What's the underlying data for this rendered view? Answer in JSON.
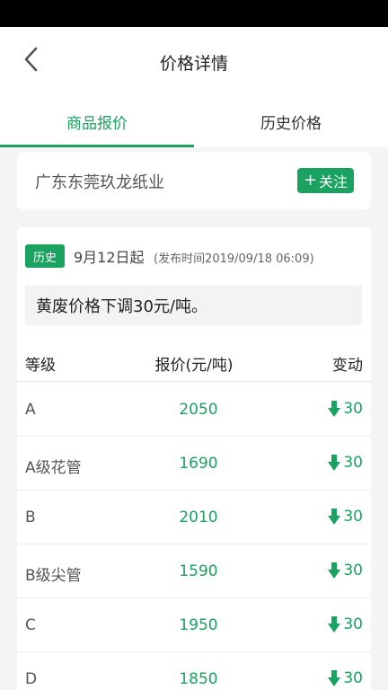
{
  "nav": {
    "title": "价格详情"
  },
  "tabs": [
    {
      "label": "商品报价",
      "active": true
    },
    {
      "label": "历史价格",
      "active": false
    }
  ],
  "company": {
    "name": "广东东莞玖龙纸业",
    "follow_plus": "+",
    "follow_label": "关注"
  },
  "detail": {
    "badge": "历史",
    "start_date": "9月12日起",
    "publish_time": "(发布时间2019/09/18 06:09)",
    "notice": "黄废价格下调30元/吨。"
  },
  "table": {
    "headers": {
      "grade": "等级",
      "price": "报价(元/吨)",
      "change": "变动"
    },
    "rows": [
      {
        "grade": "A",
        "price": "2050",
        "change": "30"
      },
      {
        "grade": "A级花管",
        "price": "1690",
        "change": "30"
      },
      {
        "grade": "B",
        "price": "2010",
        "change": "30"
      },
      {
        "grade": "B级尖管",
        "price": "1590",
        "change": "30"
      },
      {
        "grade": "C",
        "price": "1950",
        "change": "30"
      },
      {
        "grade": "D",
        "price": "1850",
        "change": "30"
      }
    ]
  },
  "colors": {
    "accent": "#1aa260"
  },
  "icons": {
    "back": "chevron-left-icon",
    "change": "arrow-down-icon"
  }
}
